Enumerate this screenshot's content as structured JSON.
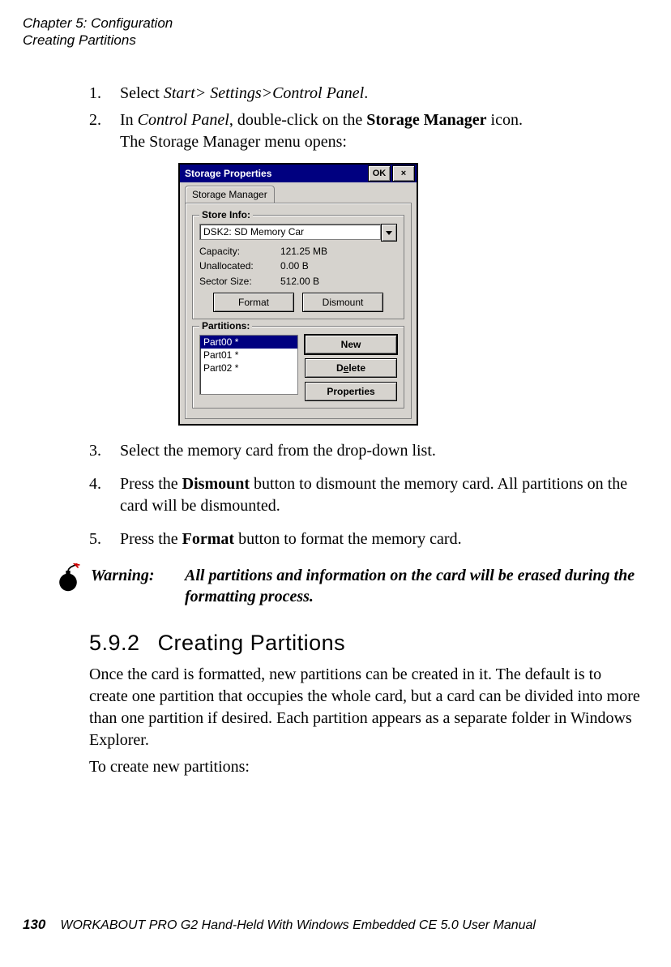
{
  "header": {
    "line1": "Chapter 5: Configuration",
    "line2": "Creating Partitions"
  },
  "steps": {
    "s1_num": "1.",
    "s1_a": "Select ",
    "s1_b": "Start> Settings>Control Panel",
    "s1_c": ".",
    "s2_num": "2.",
    "s2_a": "In ",
    "s2_b": "Control Panel",
    "s2_c": ", double-click on the ",
    "s2_d": "Storage Manager",
    "s2_e": " icon.",
    "s2_f": "The Storage Manager menu opens:",
    "s3_num": "3.",
    "s3": "Select the memory card from the drop-down list.",
    "s4_num": "4.",
    "s4_a": "Press the ",
    "s4_b": "Dismount",
    "s4_c": " button to dismount the memory card. All partitions on the card will be dismounted.",
    "s5_num": "5.",
    "s5_a": "Press the ",
    "s5_b": "Format",
    "s5_c": " button to format the memory card."
  },
  "shot": {
    "title": "Storage Properties",
    "ok": "OK",
    "close": "×",
    "tab": "Storage Manager",
    "group1": "Store Info:",
    "combo": "DSK2: SD Memory Car",
    "capacity_k": "Capacity:",
    "capacity_v": "121.25 MB",
    "unalloc_k": "Unallocated:",
    "unalloc_v": "0.00 B",
    "sector_k": "Sector Size:",
    "sector_v": "512.00 B",
    "format_btn": "Format",
    "dismount_btn": "Dismount",
    "group2": "Partitions:",
    "parts": [
      "Part00 *",
      "Part01 *",
      "Part02 *"
    ],
    "new_btn": "New",
    "delete_btn": "Delete",
    "props_btn": "Properties"
  },
  "warning": {
    "label": "Warning:",
    "text": "All partitions and information on the card will be erased during the formatting process."
  },
  "section": {
    "num": "5.9.2",
    "title": "Creating Partitions",
    "p1": "Once the card is formatted, new partitions can be created in it. The default is to create one partition that occupies the whole card, but a card can be divided into more than one partition if desired. Each partition appears as a separate folder in Windows Explorer.",
    "p2": "To create new partitions:"
  },
  "footer": {
    "page": "130",
    "text": "WORKABOUT PRO G2 Hand-Held With Windows Embedded CE 5.0 User Manual"
  }
}
